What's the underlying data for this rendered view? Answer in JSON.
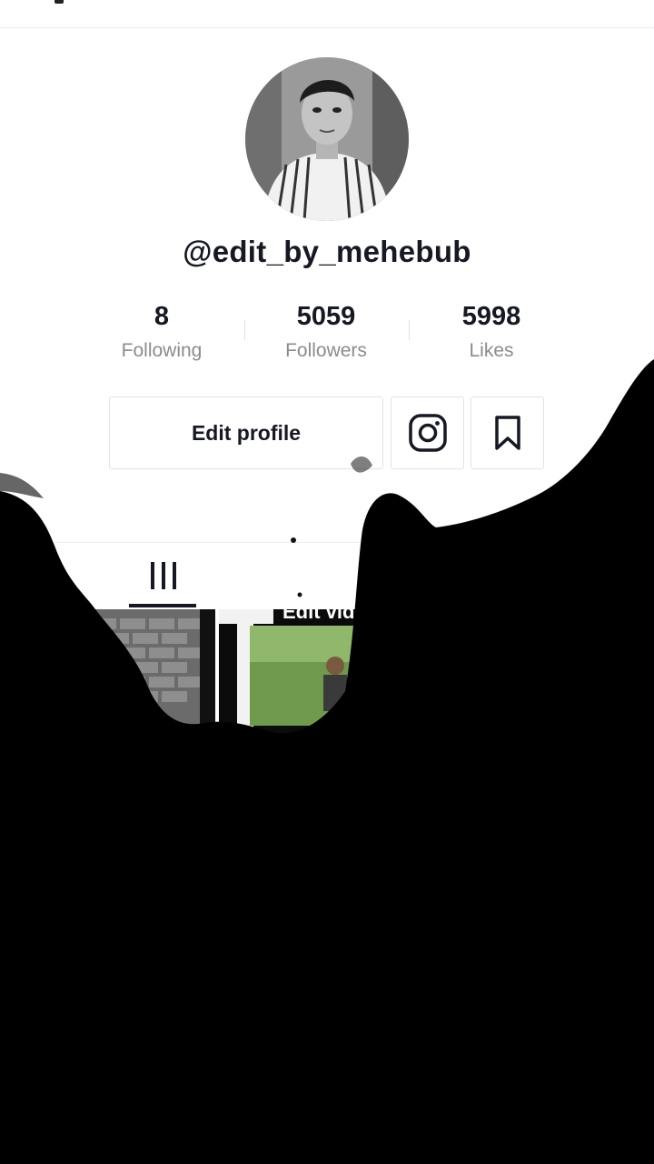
{
  "profile": {
    "username": "@edit_by_mehebub"
  },
  "stats": [
    {
      "value": "8",
      "label": "Following"
    },
    {
      "value": "5059",
      "label": "Followers"
    },
    {
      "value": "5998",
      "label": "Likes"
    }
  ],
  "actions": {
    "edit_profile": "Edit profile"
  },
  "videos": [
    {
      "title": ""
    },
    {
      "title": "Edit vid"
    }
  ],
  "icons": {
    "instagram": "instagram-icon",
    "bookmark": "bookmark-icon",
    "grid": "videos-grid-icon"
  },
  "colors": {
    "text": "#161823",
    "muted": "#8a8b91",
    "border": "#e3e3e4",
    "overlay": "#000000"
  }
}
